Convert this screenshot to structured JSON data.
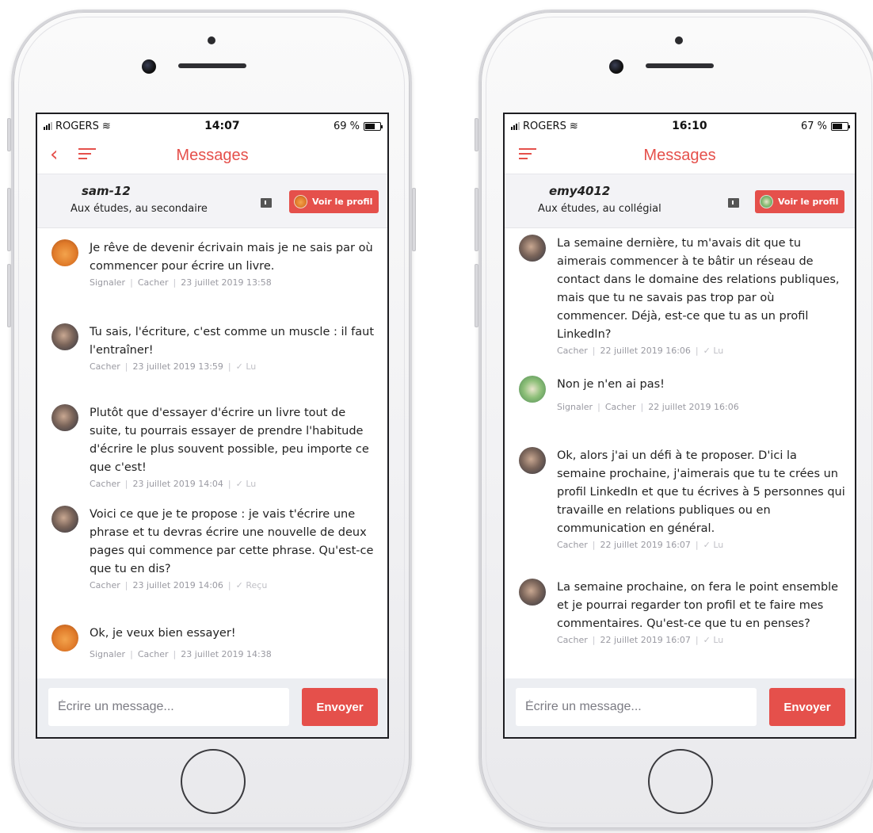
{
  "colors": {
    "accent": "#e5504b",
    "text": "#222222",
    "muted": "#9a9aa2",
    "bar": "#f3f3f6"
  },
  "phones": [
    {
      "status": {
        "carrier": "ROGERS",
        "time": "14:07",
        "battery": "69 %",
        "battery_level": 0.69
      },
      "nav": {
        "title": "Messages"
      },
      "profile": {
        "name": "sam-12",
        "status": "Aux études, au secondaire",
        "button": "Voir le profil"
      },
      "messages": [
        {
          "author": "student",
          "text": "Je rêve de devenir écrivain mais je ne sais par où commencer pour écrire un livre.",
          "actions": [
            "Signaler",
            "Cacher"
          ],
          "date": "23 juillet 2019 13:58",
          "receipt": ""
        },
        {
          "author": "mentor",
          "text": "Tu sais, l'écriture, c'est comme un muscle : il faut l'entraîner!",
          "actions": [
            "Cacher"
          ],
          "date": "23 juillet 2019 13:59",
          "receipt": "✓ Lu"
        },
        {
          "author": "mentor",
          "text": "Plutôt que d'essayer d'écrire un livre tout de suite, tu pourrais essayer de prendre l'habitude d'écrire le plus souvent possible, peu importe ce que c'est!",
          "actions": [
            "Cacher"
          ],
          "date": "23 juillet 2019 14:04",
          "receipt": "✓ Lu"
        },
        {
          "author": "mentor",
          "text": "Voici ce que je te propose : je vais t'écrire une phrase et tu devras écrire une nouvelle de deux pages qui commence par cette phrase. Qu'est-ce que tu en dis?",
          "actions": [
            "Cacher"
          ],
          "date": "23 juillet 2019 14:06",
          "receipt": "✓ Reçu"
        },
        {
          "author": "student",
          "text": "Ok, je veux bien essayer!",
          "actions": [
            "Signaler",
            "Cacher"
          ],
          "date": "23 juillet 2019 14:38",
          "receipt": ""
        }
      ],
      "composer": {
        "placeholder": "Écrire un message...",
        "send": "Envoyer"
      }
    },
    {
      "status": {
        "carrier": "ROGERS",
        "time": "16:10",
        "battery": "67 %",
        "battery_level": 0.67
      },
      "nav": {
        "title": "Messages"
      },
      "profile": {
        "name": "emy4012",
        "status": "Aux études, au collégial",
        "button": "Voir le profil"
      },
      "messages": [
        {
          "author": "mentor",
          "text": "La semaine dernière, tu m'avais dit que tu aimerais commencer à te bâtir un réseau de contact dans le domaine des relations publiques, mais que tu ne savais pas trop par où commencer. Déjà, est-ce que tu as un profil LinkedIn?",
          "actions": [
            "Cacher"
          ],
          "date": "22 juillet 2019 16:06",
          "receipt": "✓ Lu"
        },
        {
          "author": "student",
          "text": "Non je n'en ai pas!",
          "actions": [
            "Signaler",
            "Cacher"
          ],
          "date": "22 juillet 2019 16:06",
          "receipt": ""
        },
        {
          "author": "mentor",
          "text": "Ok, alors j'ai un défi à te proposer. D'ici la semaine prochaine, j'aimerais que tu te crées un profil LinkedIn et que tu écrives à 5 personnes qui travaille en relations publiques ou en communication en général.",
          "actions": [
            "Cacher"
          ],
          "date": "22 juillet 2019 16:07",
          "receipt": "✓ Lu"
        },
        {
          "author": "mentor",
          "text": "La semaine prochaine, on fera le point ensemble et je pourrai regarder ton profil et te faire mes commentaires. Qu'est-ce que tu en penses?",
          "actions": [
            "Cacher"
          ],
          "date": "22 juillet 2019 16:07",
          "receipt": "✓ Lu"
        }
      ],
      "composer": {
        "placeholder": "Écrire un message...",
        "send": "Envoyer"
      }
    }
  ]
}
